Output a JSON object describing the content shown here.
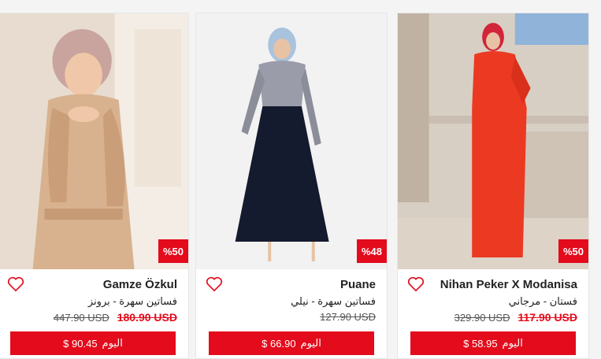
{
  "products": [
    {
      "brand": "Gamze Özkul",
      "name": "فساتين سهرة - برونز",
      "old_price": "447.90 USD",
      "new_price": "180.90 USD",
      "discount": "%50",
      "final_label": "اليوم",
      "final_price": "$ 90.45",
      "image_colors": {
        "bg": "#d9c9b8",
        "scarf": "#c9a49e",
        "dress": "#d8b28f"
      }
    },
    {
      "brand": "Puane",
      "name": "فساتين سهرة - نيلي",
      "old_price": "127.90 USD",
      "new_price": "",
      "discount": "%48",
      "final_label": "اليوم",
      "final_price": "$ 66.90",
      "image_colors": {
        "bg": "#f2f2f2",
        "scarf": "#a9c3dd",
        "top": "#9a9caa",
        "skirt": "#151b2e"
      }
    },
    {
      "brand": "Nihan Peker X Modanisa",
      "name": "فستان - مرجاني",
      "old_price": "329.90 USD",
      "new_price": "117.90 USD",
      "discount": "%50",
      "final_label": "اليوم",
      "final_price": "$ 58.95",
      "image_colors": {
        "bg": "#d8cfc4",
        "dress": "#ec3a22",
        "sky": "#8fb3d9"
      }
    }
  ],
  "accent": "#e30b1c"
}
